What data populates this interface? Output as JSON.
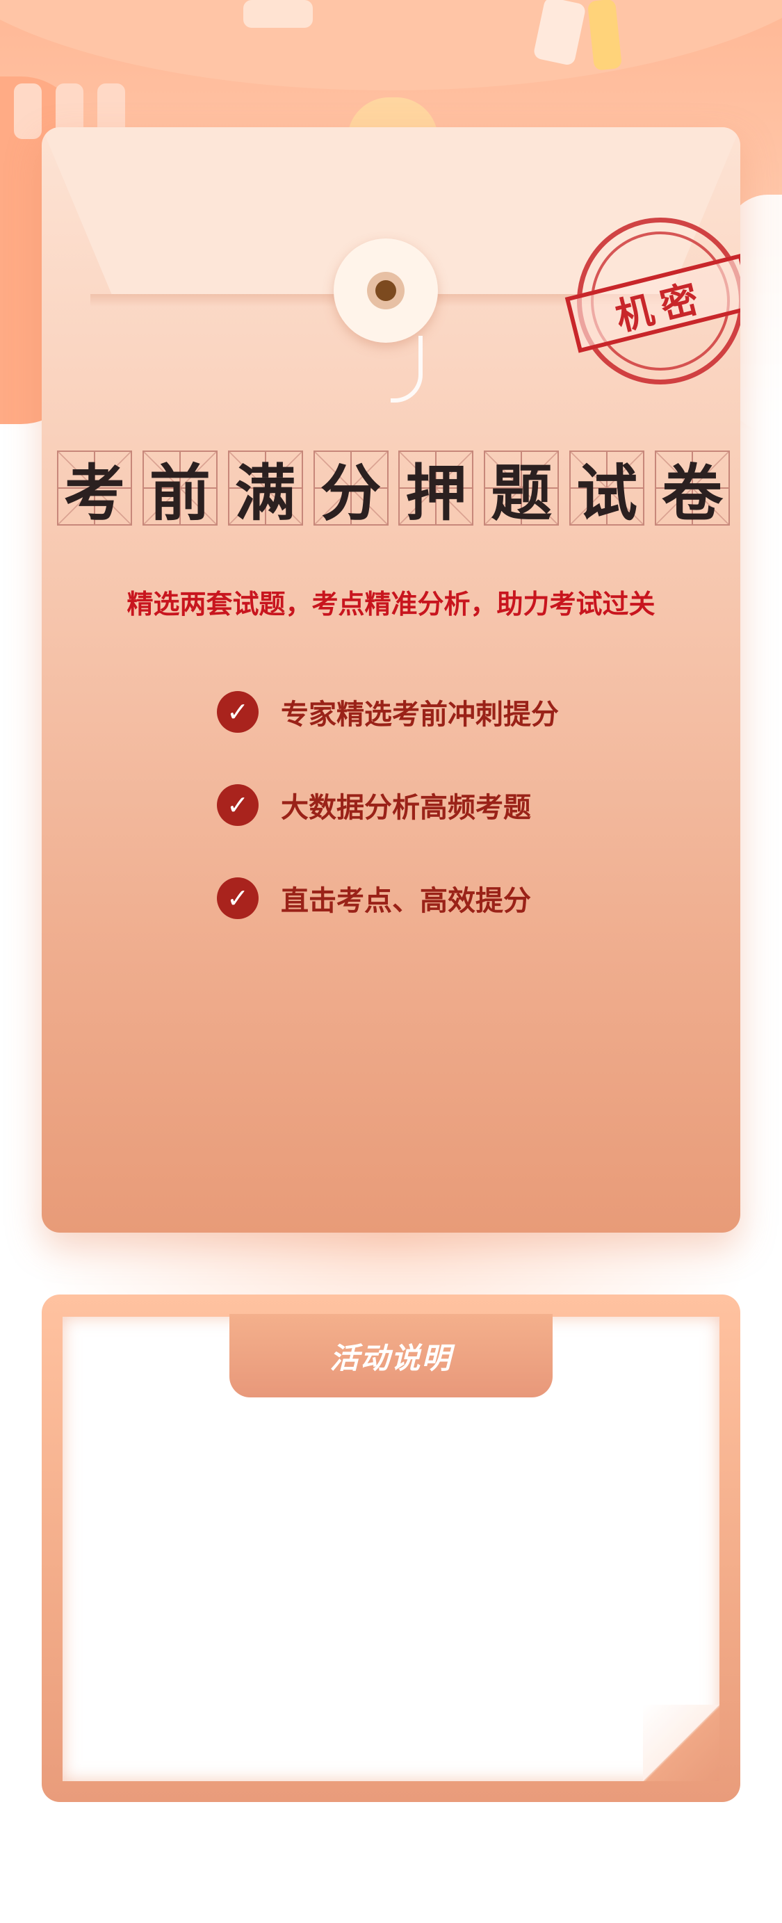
{
  "envelope": {
    "stamp_text": "机密",
    "title_chars": [
      "考",
      "前",
      "满",
      "分",
      "押",
      "题",
      "试",
      "卷"
    ],
    "subtitle": "精选两套试题，考点精准分析，助力考试过关",
    "features": [
      {
        "icon": "check-circle-icon",
        "label": "专家精选考前冲刺提分"
      },
      {
        "icon": "check-circle-icon",
        "label": "大数据分析高频考题"
      },
      {
        "icon": "check-circle-icon",
        "label": "直击考点、高效提分"
      }
    ]
  },
  "activity": {
    "tab_label": "活动说明"
  },
  "colors": {
    "accent_red": "#c8151e",
    "feature_red": "#9a2218",
    "envelope_top": "#fde3d4",
    "envelope_bottom": "#e89b78"
  }
}
